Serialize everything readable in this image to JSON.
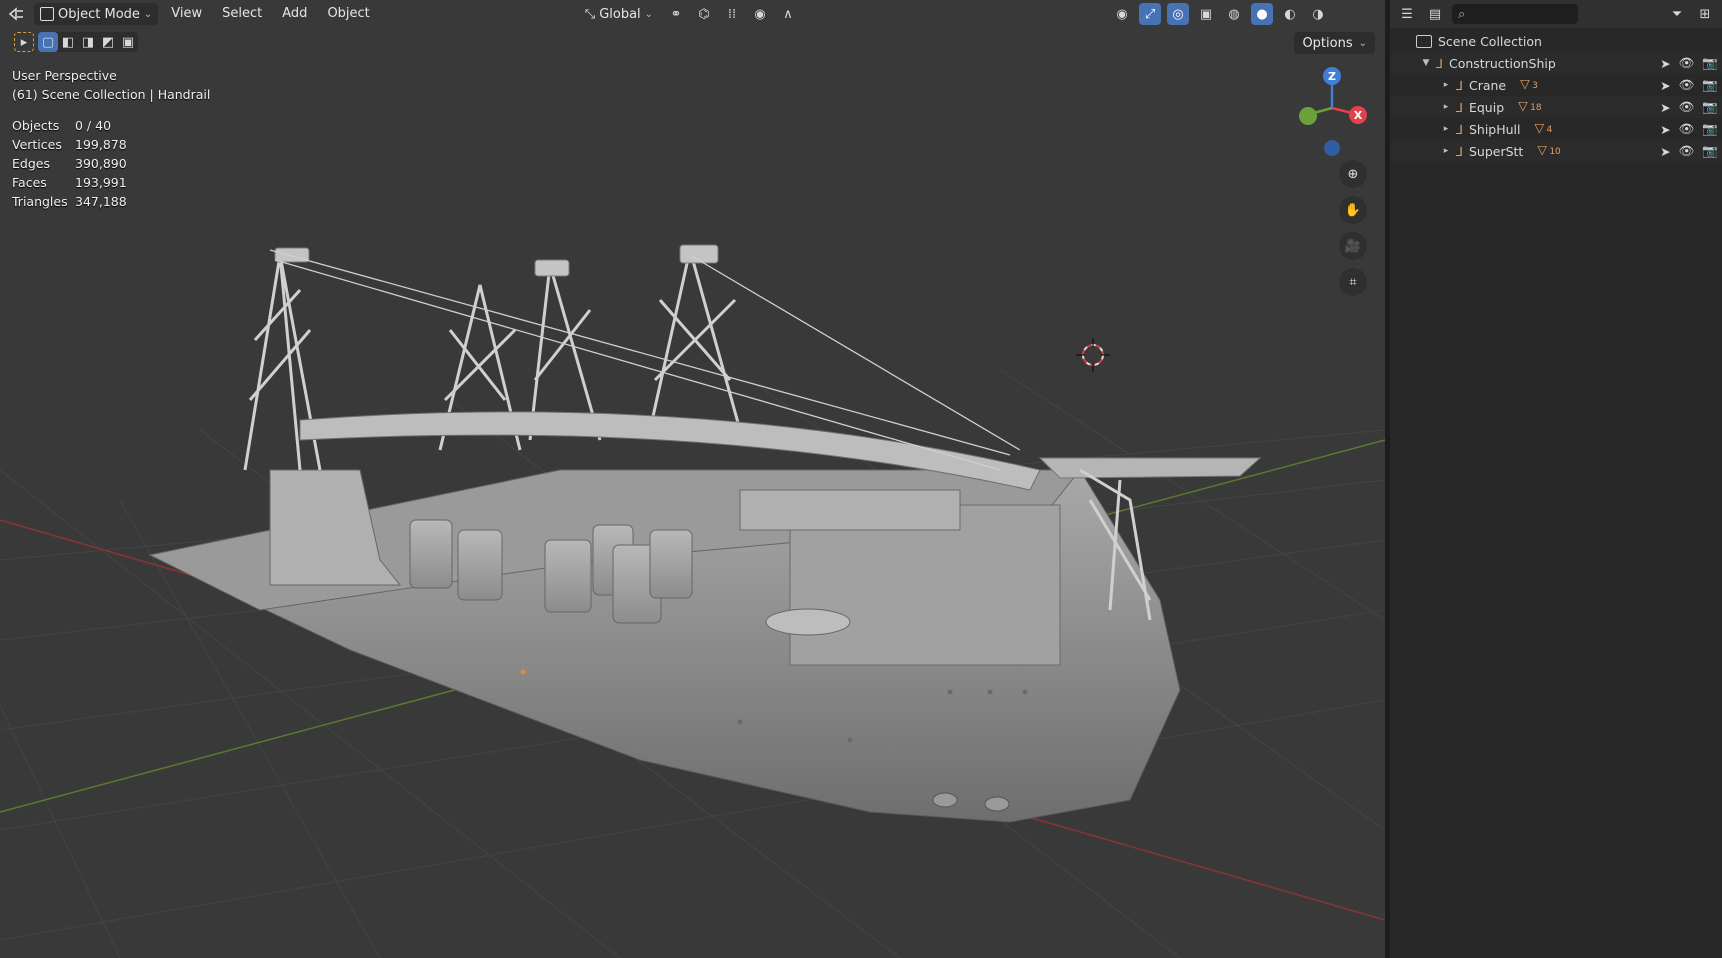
{
  "header": {
    "mode_label": "Object Mode",
    "menus": [
      "View",
      "Select",
      "Add",
      "Object"
    ],
    "transform_orientation": "Global",
    "options_label": "Options"
  },
  "viewport": {
    "perspective_label": "User Perspective",
    "context_label": "(61) Scene Collection | Handrail",
    "stats": [
      {
        "label": "Objects",
        "value": "0 / 40"
      },
      {
        "label": "Vertices",
        "value": "199,878"
      },
      {
        "label": "Edges",
        "value": "390,890"
      },
      {
        "label": "Faces",
        "value": "193,991"
      },
      {
        "label": "Triangles",
        "value": "347,188"
      }
    ],
    "gizmo": {
      "z": "Z",
      "x": "X"
    }
  },
  "outliner": {
    "root_label": "Scene Collection",
    "collection": "ConstructionShip",
    "children": [
      {
        "label": "Crane",
        "count": "3"
      },
      {
        "label": "Equip",
        "count": "18"
      },
      {
        "label": "ShipHull",
        "count": "4"
      },
      {
        "label": "SuperStt",
        "count": "10"
      }
    ]
  },
  "colors": {
    "accent": "#4772b3",
    "collection_icon": "#e39d5a",
    "axis_x": "#e2424b",
    "axis_y": "#6ca03a",
    "axis_z": "#3f7fd9"
  }
}
